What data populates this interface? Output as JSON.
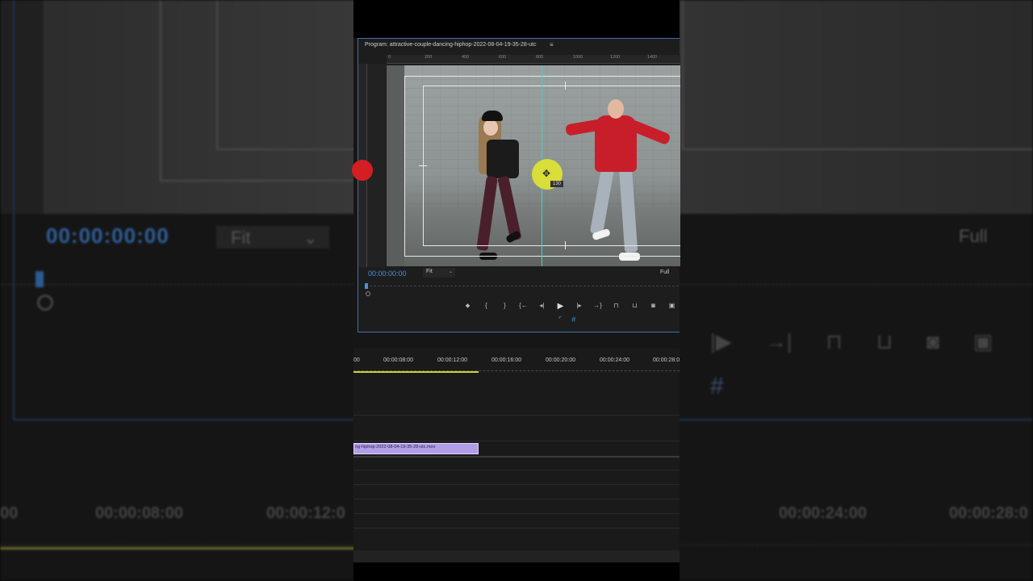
{
  "program_monitor": {
    "title": "Program: attractive-couple-dancing-hiphop-2022-08-04-19-35-28-utc",
    "menu_icon": "≡",
    "ruler_marks": [
      "0",
      "200",
      "400",
      "600",
      "800",
      "1000",
      "1200",
      "1400"
    ],
    "timecode": "00:00:00:00",
    "zoom": "Fit",
    "resolution": "Full",
    "cursor_tooltip": "130"
  },
  "transport": {
    "icons": [
      "marker-icon",
      "mark-in-icon",
      "mark-out-icon",
      "go-to-in-icon",
      "step-back-icon",
      "play-icon",
      "step-forward-icon",
      "go-to-out-icon",
      "lift-icon",
      "extract-icon",
      "export-frame-icon",
      "compare-icon"
    ],
    "glyphs": [
      "⬥",
      "{",
      "}",
      "{←",
      "◂|",
      "▶",
      "|▸",
      "→}",
      "⊓",
      "⊔",
      "◙",
      "▣"
    ]
  },
  "timeline": {
    "timecodes": [
      "00",
      "00:00:08:00",
      "00:00:12:00",
      "00:00:16:00",
      "00:00:20:00",
      "00:00:24:00",
      "00:00:28:0"
    ],
    "clip_label": "ng-hiphop-2022-08-04-19-35-28-utc.mov"
  },
  "background": {
    "timecode": "00:00:00:00",
    "zoom": "Fit",
    "resolution": "Full",
    "timeline_times": [
      "00",
      "00:00:08:00",
      "00:00:12:0",
      "00:00:24:00",
      "00:00:28:0"
    ]
  },
  "colors": {
    "accent": "#4a90e2",
    "clip": "#b29ee6",
    "guide": "#3fd3c8",
    "work_area": "#cfd23a"
  }
}
